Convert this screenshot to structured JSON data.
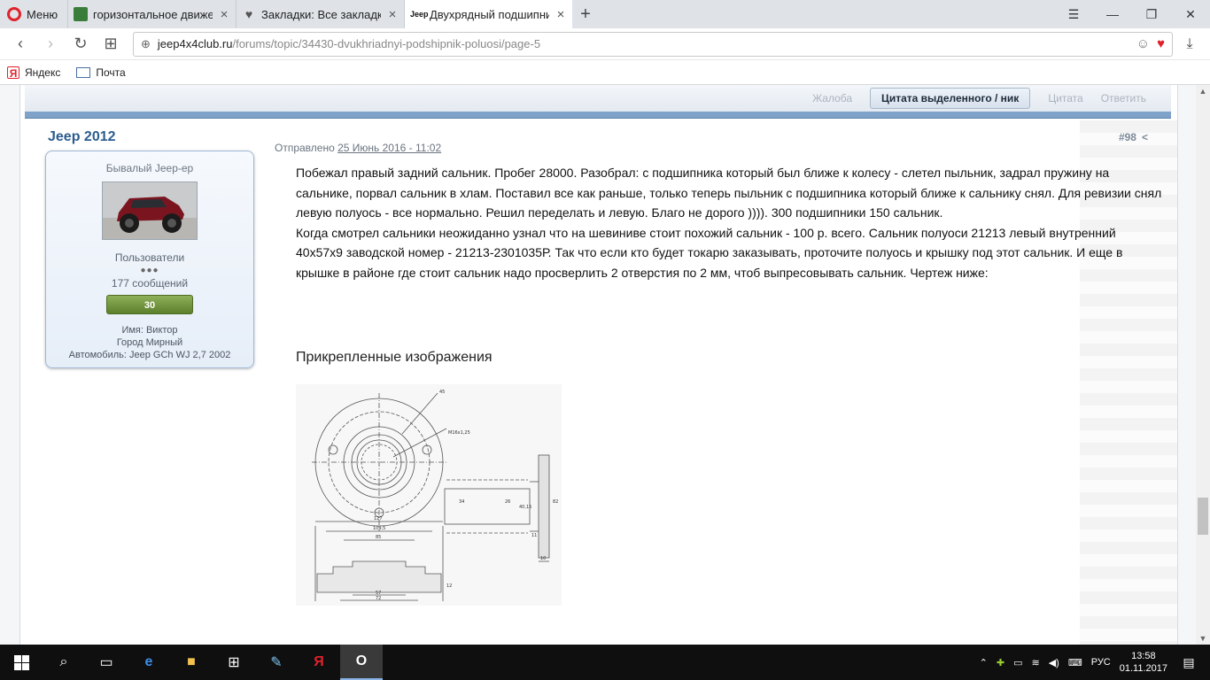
{
  "browser": {
    "menu_label": "Меню",
    "tabs": [
      {
        "title": "горизонтальное движени",
        "icon": "game-favicon-icon"
      },
      {
        "title": "Закладки: Все закладки",
        "icon": "heart-favicon-icon"
      },
      {
        "title": "Двухрядный подшипник",
        "icon": "jeep-favicon-icon",
        "active": true
      }
    ],
    "url_host": "jeep4x4club.ru",
    "url_path": "/forums/topic/34430-dvukhriadnyi-podshipnik-poluosi/page-5",
    "bookmarks": [
      {
        "label": "Яндекс",
        "icon": "yandex-icon"
      },
      {
        "label": "Почта",
        "icon": "mail-icon"
      }
    ]
  },
  "post_actions": {
    "report": "Жалоба",
    "quote_selection": "Цитата выделенного / ник",
    "quote": "Цитата",
    "reply": "Ответить"
  },
  "post": {
    "author": "Jeep 2012",
    "sent_label": "Отправлено",
    "date": "25 Июнь 2016 - 11:02",
    "number": "#98",
    "body_lines": [
      "Побежал правый задний сальник. Пробег 28000. Разобрал: с подшипника который был ближе к колесу - слетел пыльник, задрал пружину на",
      "сальнике, порвал сальник в хлам. Поставил все как раньше, только теперь пыльник с подшипника который ближе к сальнику снял. Для ревизии снял",
      "левую полуось - все нормально. Решил переделать и левую. Благо не дорого )))). 300 подшипники 150 сальник.",
      "Когда смотрел сальники неожиданно узнал что на шевиниве стоит похожий сальник - 100 р. всего.  Сальник полуоси 21213 левый внутренний",
      "40х57х9 заводской номер - 21213-2301035Р. Так что если кто будет токарю заказывать, проточите полуось и крышку под этот сальник. И еще в",
      "крышке в районе где стоит сальник надо просверлить 2 отверстия по 2 мм, чтоб выпресовывать сальник. Чертеж ниже:"
    ],
    "attachments_title": "Прикрепленные изображения"
  },
  "author_card": {
    "rank": "Бывалый Jeep-ер",
    "group": "Пользователи",
    "pips": "●●●",
    "posts": "177 сообщений",
    "reputation": "30",
    "name": "Имя: Виктор",
    "city": "Город Мирный",
    "car": "Автомобиль: Jeep GCh WJ 2,7 2002"
  },
  "drawing_labels": {
    "thread": "М16х1,25",
    "d45": "45",
    "d127": "127",
    "d109": "109,5",
    "d85": "85",
    "d57": "57",
    "d72": "72",
    "d34": "34",
    "d26": "26",
    "d40": "40,15",
    "d82": "82",
    "d11": "11",
    "d10": "10",
    "d12": "12"
  },
  "taskbar": {
    "lang": "РУС",
    "time": "13:58",
    "date": "01.11.2017"
  },
  "colors": {
    "accent": "#2c5c8e",
    "action_bar_rule": "#7fa3c8",
    "reputation": "#6b8f3b",
    "opera_red": "#e0222b"
  }
}
